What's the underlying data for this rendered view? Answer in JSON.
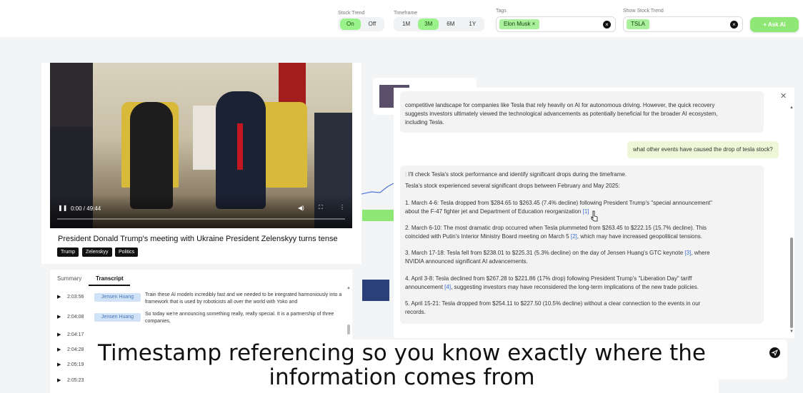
{
  "topbar": {
    "stock_trend": {
      "label": "Stock Trend",
      "options": [
        "On",
        "Off"
      ],
      "selected": "On"
    },
    "timeframe": {
      "label": "Timeframe",
      "options": [
        "1M",
        "3M",
        "6M",
        "1Y"
      ],
      "selected": "3M"
    },
    "tags": {
      "label": "Tags",
      "chip": "Elon Musk ×"
    },
    "show_stock_trend": {
      "label": "Show Stock Trend",
      "chip": "TSLA"
    },
    "ask_ai": "+ Ask AI",
    "accent": "#9af28a"
  },
  "video": {
    "time": "0:00 / 49:44",
    "title": "President Donald Trump's meeting with Ukraine President Zelenskyy turns tense",
    "tags": [
      "Trump",
      "Zelenskyy",
      "Politics"
    ]
  },
  "transcript": {
    "tabs": [
      "Summary",
      "Transcript"
    ],
    "active_tab": "Transcript",
    "rows": [
      {
        "time": "2:03:56",
        "speaker": "Jensen Huang",
        "text": "Train these AI models incredibly fast and we needed to be integrated harmoniously into a framework that is used by roboticists all over the world with Yoko and"
      },
      {
        "time": "2:04:08",
        "speaker": "Jensen Huang",
        "text": "So today we're announcing something really, really special. It is a partnership of three companies,"
      },
      {
        "time": "2:04:17",
        "speaker": "",
        "text": ""
      },
      {
        "time": "2:04:28",
        "speaker": "",
        "text": ""
      },
      {
        "time": "2:05:19",
        "speaker": "",
        "text": ""
      },
      {
        "time": "2:05:23",
        "speaker": "",
        "text": ""
      }
    ]
  },
  "chat": {
    "prev_line1": "competitive landscape for companies like Tesla that rely heavily on AI for autonomous driving. However, the quick recovery",
    "prev_line2": "suggests investors ultimately viewed the technological advancements as potentially beneficial for the broader AI ecosystem,",
    "prev_line3": "including Tesla.",
    "user_question": "what other events have caused the drop of tesla stock?",
    "intro1": "I'll check Tesla's stock performance and identify significant drops during the timeframe.",
    "intro2": "Tesla's stock experienced several significant drops between February and May 2025:",
    "items": [
      {
        "line1": "1. March 4-6: Tesla dropped from $284.65 to $263.45 (7.4% decline) following President Trump's \"special announcement\"",
        "line2": "about the F-47 fighter jet and Department of Education reorganization",
        "ref": "[1]"
      },
      {
        "line1": "2. March 6-10: The most dramatic drop occurred when Tesla plummeted from $263.45 to $222.15 (15.7% decline). This",
        "line2": "coincided with Putin's Interior Ministry Board meeting on March 5",
        "ref": "[2]",
        "tail": ", which may have increased geopolitical tensions."
      },
      {
        "line1": "3. March 17-18: Tesla fell from $238.01 to $225.31 (5.3% decline) on the day of Jensen Huang's GTC keynote",
        "ref1": "[3]",
        "tail1": ", where",
        "line2": "NVIDIA announced significant AI advancements."
      },
      {
        "line1": "4. April 3-8: Tesla declined from $267.28 to $221.86 (17% drop) following President Trump's \"Liberation Day\" tariff",
        "line2pre": "announcement",
        "ref": "[4]",
        "line2": ", suggesting investors may have reconsidered the long-term implications of the new trade policies."
      },
      {
        "line1": "5. April 15-21: Tesla dropped from $254.11 to $227.50 (10.5% decline) without a clear connection to the events in our",
        "line2": "records."
      }
    ]
  },
  "caption": {
    "line1": "Timestamp referencing so you know exactly where the",
    "line2": "information comes from"
  }
}
